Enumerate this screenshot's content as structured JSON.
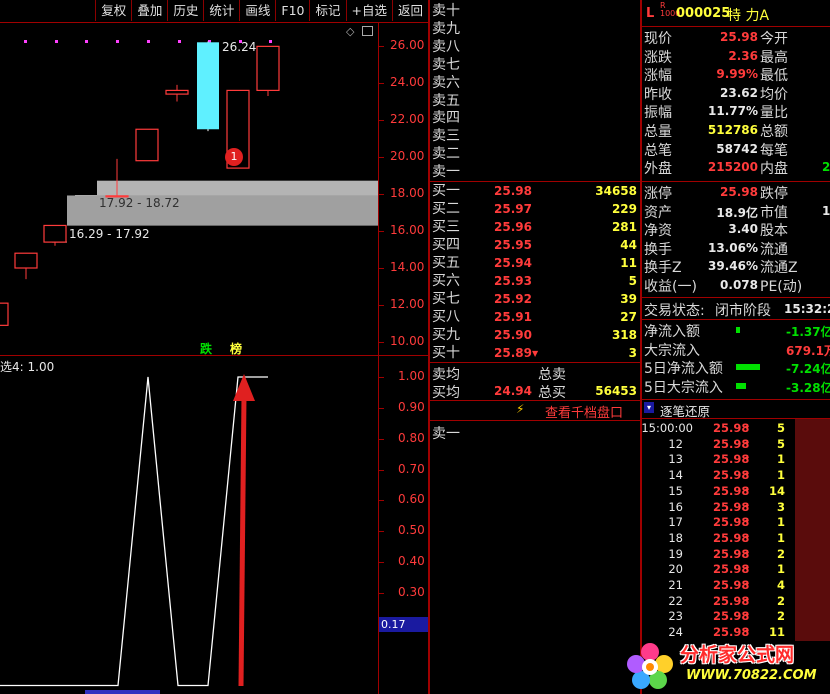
{
  "toolbar": {
    "buttons": [
      "复权",
      "叠加",
      "历史",
      "统计",
      "画线",
      "F10",
      "标记",
      "+自选",
      "返回"
    ]
  },
  "kline": {
    "y_ticks": [
      "26.00",
      "24.00",
      "22.00",
      "20.00",
      "18.00",
      "16.00",
      "14.00",
      "12.00",
      "10.00"
    ],
    "high_label": "26.24",
    "zone_upper_label": "17.92 - 18.72",
    "zone_lower_label": "16.29 - 17.92",
    "marker_number": "1",
    "tag_left": "跌",
    "tag_right": "榜",
    "candles": [
      {
        "open": 10.9,
        "close": 12.1,
        "high": 12.3,
        "low": 10.7,
        "up": true
      },
      {
        "open": 14.0,
        "close": 14.8,
        "high": 14.8,
        "low": 13.4,
        "up": true
      },
      {
        "open": 15.4,
        "close": 16.3,
        "high": 16.3,
        "low": 15.2,
        "up": true
      },
      {
        "open": 17.9,
        "close": 17.9,
        "high": 19.9,
        "low": 17.9,
        "up": true
      },
      {
        "open": 19.8,
        "close": 21.5,
        "high": 21.5,
        "low": 19.8,
        "up": true
      },
      {
        "open": 23.4,
        "close": 23.6,
        "high": 23.9,
        "low": 23.0,
        "up": true
      },
      {
        "open": 26.2,
        "close": 21.5,
        "high": 26.24,
        "low": 21.4,
        "up": false
      },
      {
        "open": 19.4,
        "close": 23.6,
        "high": 23.6,
        "low": 19.4,
        "up": true
      },
      {
        "open": 23.6,
        "close": 25.98,
        "high": 25.98,
        "low": 23.3,
        "up": true
      }
    ],
    "colors": {
      "up": "#ff3b3b",
      "down": "#5ff0ff",
      "zone": "#a0a0a0"
    }
  },
  "indicator": {
    "label": "选4: 1.00",
    "y_ticks": [
      "1.00",
      "0.90",
      "0.80",
      "0.70",
      "0.60",
      "0.50",
      "0.40",
      "0.30",
      "0.20"
    ],
    "current_value": "0.17",
    "series": [
      0,
      0,
      0,
      0,
      0,
      1,
      0,
      0,
      0,
      1,
      1
    ]
  },
  "orders": {
    "sell_labels": [
      "卖十",
      "卖九",
      "卖八",
      "卖七",
      "卖六",
      "卖五",
      "卖四",
      "卖三",
      "卖二",
      "卖一"
    ],
    "buy": [
      {
        "label": "买一",
        "price": "25.98",
        "vol": "34658"
      },
      {
        "label": "买二",
        "price": "25.97",
        "vol": "229"
      },
      {
        "label": "买三",
        "price": "25.96",
        "vol": "281"
      },
      {
        "label": "买四",
        "price": "25.95",
        "vol": "44"
      },
      {
        "label": "买五",
        "price": "25.94",
        "vol": "11"
      },
      {
        "label": "买六",
        "price": "25.93",
        "vol": "5"
      },
      {
        "label": "买七",
        "price": "25.92",
        "vol": "39"
      },
      {
        "label": "买八",
        "price": "25.91",
        "vol": "27"
      },
      {
        "label": "买九",
        "price": "25.90",
        "vol": "318"
      },
      {
        "label": "买十",
        "price": "25.89",
        "vol": "3"
      }
    ],
    "avg_sell_label": "卖均",
    "avg_buy_label": "买均",
    "avg_buy_price": "24.94",
    "total_sell_label": "总卖",
    "total_buy_label": "总买",
    "total_buy_vol": "56453",
    "thousand_link": "查看千档盘口",
    "bottom_sell1": "卖一"
  },
  "quote": {
    "prefix": "L",
    "code": "000025",
    "name": "特 力A",
    "rows": [
      {
        "l1": "现价",
        "v1": "25.98",
        "c1": "red",
        "l2": "今开"
      },
      {
        "l1": "涨跌",
        "v1": "2.36",
        "c1": "red",
        "l2": "最高"
      },
      {
        "l1": "涨幅",
        "v1": "9.99%",
        "c1": "red",
        "l2": "最低"
      },
      {
        "l1": "昨收",
        "v1": "23.62",
        "c1": "wht",
        "l2": "均价"
      },
      {
        "l1": "振幅",
        "v1": "11.77%",
        "c1": "wht",
        "l2": "量比"
      },
      {
        "l1": "总量",
        "v1": "512786",
        "c1": "yel",
        "l2": "总额"
      },
      {
        "l1": "总笔",
        "v1": "58742",
        "c1": "wht",
        "l2": "每笔"
      },
      {
        "l1": "外盘",
        "v1": "215200",
        "c1": "red",
        "l2": "内盘",
        "v2": "2"
      }
    ],
    "rows2": [
      {
        "l1": "涨停",
        "v1": "25.98",
        "c1": "red",
        "l2": "跌停"
      },
      {
        "l1": "资产",
        "v1": "18.9亿",
        "c1": "wht",
        "l2": "市值",
        "v2": "1"
      },
      {
        "l1": "净资",
        "v1": "3.40",
        "c1": "wht",
        "l2": "股本"
      },
      {
        "l1": "换手",
        "v1": "13.06%",
        "c1": "wht",
        "l2": "流通"
      },
      {
        "l1": "换手Z",
        "v1": "39.46%",
        "c1": "wht",
        "l2": "流通Z"
      },
      {
        "l1": "收益(一)",
        "v1": "0.078",
        "c1": "wht",
        "l2": "PE(动)"
      }
    ],
    "status_label": "交易状态:",
    "status_value": "闭市阶段",
    "status_time": "15:32:2",
    "flows": [
      {
        "label": "净流入额",
        "value": "-1.37亿",
        "color": "grn",
        "bar": 4
      },
      {
        "label": "大宗流入",
        "value": "679.1万",
        "color": "red",
        "bar": 0
      },
      {
        "label": "5日净流入额",
        "value": "-7.24亿",
        "color": "grn",
        "bar": 24
      },
      {
        "label": "5日大宗流入",
        "value": "-3.28亿",
        "color": "grn",
        "bar": 10
      }
    ]
  },
  "ticks": {
    "header": "逐笔还原",
    "rows": [
      {
        "t": "15:00:00",
        "p": "25.98",
        "v": "5"
      },
      {
        "t": "12",
        "p": "25.98",
        "v": "5"
      },
      {
        "t": "13",
        "p": "25.98",
        "v": "1"
      },
      {
        "t": "14",
        "p": "25.98",
        "v": "1"
      },
      {
        "t": "15",
        "p": "25.98",
        "v": "14"
      },
      {
        "t": "16",
        "p": "25.98",
        "v": "3"
      },
      {
        "t": "17",
        "p": "25.98",
        "v": "1"
      },
      {
        "t": "18",
        "p": "25.98",
        "v": "1"
      },
      {
        "t": "19",
        "p": "25.98",
        "v": "2"
      },
      {
        "t": "20",
        "p": "25.98",
        "v": "1"
      },
      {
        "t": "21",
        "p": "25.98",
        "v": "4"
      },
      {
        "t": "22",
        "p": "25.98",
        "v": "2"
      },
      {
        "t": "23",
        "p": "25.98",
        "v": "2"
      },
      {
        "t": "24",
        "p": "25.98",
        "v": "11"
      }
    ]
  },
  "watermark": {
    "title": "分析家公式网",
    "url": "WWW.70822.COM"
  }
}
